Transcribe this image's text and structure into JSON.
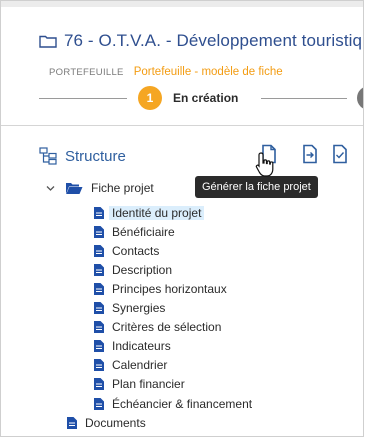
{
  "header": {
    "title": "76 - O.T.V.A. - Développement touristiq",
    "breadcrumb_parent": "PORTEFEUILLE",
    "breadcrumb_current": "Portefeuille - modèle de fiche",
    "step_number": "1",
    "step_label": "En création"
  },
  "structure": {
    "title": "Structure",
    "tooltip": "Générer la fiche projet"
  },
  "tree": {
    "root_label": "Fiche projet",
    "children": [
      "Identité du projet",
      "Bénéficiaire",
      "Contacts",
      "Description",
      "Principes horizontaux",
      "Synergies",
      "Critères de sélection",
      "Indicateurs",
      "Calendrier",
      "Plan financier",
      "Échéancier & financement"
    ],
    "documents_label": "Documents"
  },
  "colors": {
    "accent": "#2f4f8f",
    "step": "#f5a623",
    "selected_bg": "#dbeefc"
  }
}
